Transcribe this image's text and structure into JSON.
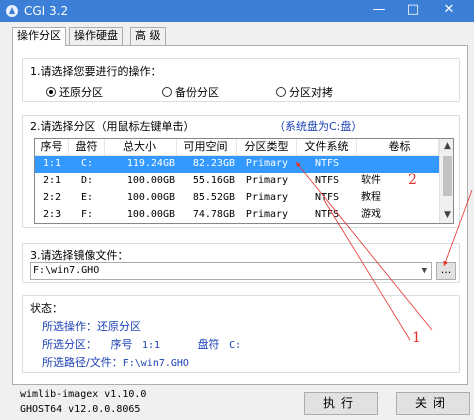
{
  "window": {
    "title": "CGI 3.2",
    "min": "—",
    "max": "□",
    "close": "✕"
  },
  "tabs": [
    {
      "label": "操作分区",
      "active": true
    },
    {
      "label": "操作硬盘",
      "active": false
    },
    {
      "label": "高 级",
      "active": false
    }
  ],
  "operation": {
    "label": "1.请选择您要进行的操作：",
    "options": [
      {
        "label": "还原分区",
        "selected": true
      },
      {
        "label": "备份分区",
        "selected": false
      },
      {
        "label": "分区对拷",
        "selected": false
      }
    ]
  },
  "partition": {
    "label": "2.请选择分区（用鼠标左键单击）",
    "system_note": "（系统盘为C:盘）",
    "columns": [
      "序号",
      "盘符",
      "总大小",
      "可用空间",
      "分区类型",
      "文件系统",
      "卷标"
    ],
    "rows": [
      [
        "1:1",
        "C:",
        "119.24GB",
        "82.23GB",
        "Primary",
        "NTFS",
        ""
      ],
      [
        "2:1",
        "D:",
        "100.00GB",
        "55.16GB",
        "Primary",
        "NTFS",
        "软件"
      ],
      [
        "2:2",
        "E:",
        "100.00GB",
        "85.52GB",
        "Primary",
        "NTFS",
        "教程"
      ],
      [
        "2:3",
        "F:",
        "100.00GB",
        "74.78GB",
        "Primary",
        "NTFS",
        "游戏"
      ]
    ],
    "selected_row": 0
  },
  "image": {
    "label": "3.请选择镜像文件：",
    "value": "F:\\win7.GHO",
    "browse_label": "..."
  },
  "status": {
    "label": "状态：",
    "operation_label": "所选操作：",
    "operation_value": "还原分区",
    "partition_label": "所选分区：",
    "partition_index_label": "序号",
    "partition_index": "1:1",
    "drive_label": "盘符",
    "drive": "C:",
    "path_label": "所选路径/文件：",
    "path_value": "F:\\win7.GHO"
  },
  "footer": {
    "wimlib": "wimlib-imagex v1.10.0",
    "ghost": "GHOST64 v12.0.0.8065",
    "execute_label": "执行",
    "close_label": "关闭"
  },
  "annotations": {
    "marker_1": "1",
    "marker_2": "2",
    "color": "#e8302a"
  },
  "colors": {
    "titlebar": "#3b7fd6",
    "selection": "#3399ff",
    "status_text": "#1a3fb4",
    "note_text": "#1a3fb4"
  }
}
